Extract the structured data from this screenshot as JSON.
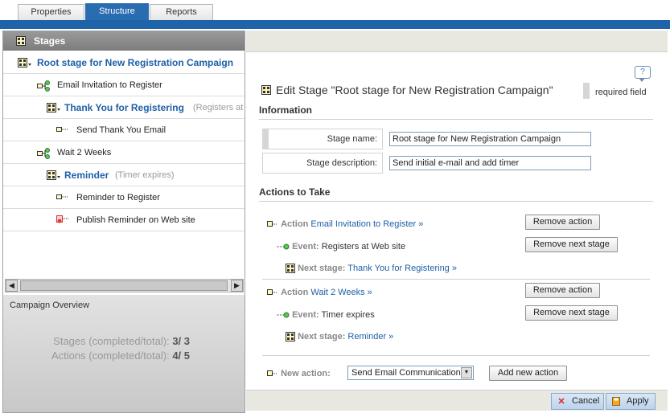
{
  "tabs": [
    {
      "label": "Properties",
      "active": false
    },
    {
      "label": "Structure",
      "active": true
    },
    {
      "label": "Reports",
      "active": false
    }
  ],
  "left": {
    "header": "Stages",
    "tree": [
      {
        "label": "Root stage for New Registration Campaign",
        "hint": "",
        "icon": "stage-group-icon",
        "kind": "stage"
      },
      {
        "label": "Email Invitation to Register",
        "hint": "",
        "icon": "action-branch-icon",
        "kind": "action"
      },
      {
        "label": "Thank You for Registering",
        "hint": "(Registers at W",
        "icon": "stage-group-icon",
        "kind": "stage"
      },
      {
        "label": "Send Thank You Email",
        "hint": "",
        "icon": "email-action-icon",
        "kind": "action"
      },
      {
        "label": "Wait 2 Weeks",
        "hint": "",
        "icon": "action-branch-icon",
        "kind": "action"
      },
      {
        "label": "Reminder",
        "hint": "(Timer expires)",
        "icon": "stage-group-icon",
        "kind": "stage"
      },
      {
        "label": "Reminder to Register",
        "hint": "",
        "icon": "email-action-icon",
        "kind": "action"
      },
      {
        "label": "Publish Reminder on Web site",
        "hint": "",
        "icon": "web-publish-icon",
        "kind": "action"
      }
    ],
    "overview": {
      "title": "Campaign Overview",
      "stages_label": "Stages (completed/total):",
      "stages_value": "3/ 3",
      "actions_label": "Actions (completed/total):",
      "actions_value": "4/ 5"
    }
  },
  "right": {
    "edit_title": "Edit Stage \"Root stage for New Registration Campaign\"",
    "help": "?",
    "required": "required field",
    "information": "Information",
    "fields": {
      "stage_name_label": "Stage name:",
      "stage_name_value": "Root stage for New Registration Campaign",
      "stage_desc_label": "Stage description:",
      "stage_desc_value": "Send initial e-mail and add timer"
    },
    "actions_heading": "Actions to Take",
    "actions": [
      {
        "action_label": "Action",
        "action_link": "Email Invitation to Register »",
        "event_label": "Event:",
        "event_text": "Registers at Web site",
        "next_label": "Next stage:",
        "next_link": "Thank You for Registering »",
        "remove_action": "Remove action",
        "remove_next": "Remove next stage"
      },
      {
        "action_label": "Action",
        "action_link": "Wait 2 Weeks »",
        "event_label": "Event:",
        "event_text": "Timer expires",
        "next_label": "Next stage:",
        "next_link": "Reminder »",
        "remove_action": "Remove action",
        "remove_next": "Remove next stage"
      }
    ],
    "new_action_label": "New action:",
    "new_action_selected": "Send Email Communication",
    "add_new_action": "Add new action",
    "cancel": "Cancel",
    "apply": "Apply"
  },
  "colors": {
    "accent": "#1f64a8",
    "link": "#1f5fa8",
    "header_gray": "#8a8a8a"
  }
}
